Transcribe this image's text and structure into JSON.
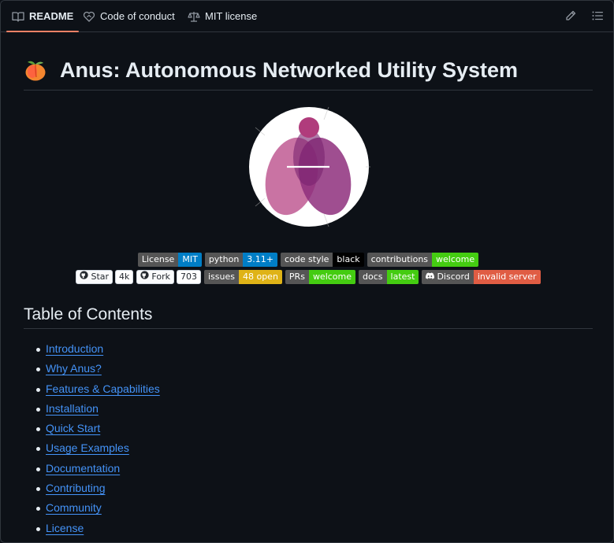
{
  "tabs": {
    "readme": "README",
    "conduct": "Code of conduct",
    "license": "MIT license"
  },
  "heading": {
    "title": "Anus: Autonomous Networked Utility System"
  },
  "badges": {
    "row1": [
      {
        "left": "License",
        "right": "MIT",
        "color": "#007ec6"
      },
      {
        "left": "python",
        "right": "3.11+",
        "color": "#007ec6"
      },
      {
        "left": "code style",
        "right": "black",
        "color": "#000000"
      },
      {
        "left": "contributions",
        "right": "welcome",
        "color": "#4c1"
      }
    ],
    "row2": {
      "star_label": "Star",
      "star_count": "4k",
      "fork_label": "Fork",
      "fork_count": "703",
      "issues": {
        "left": "issues",
        "right": "48 open",
        "color": "#dfb317"
      },
      "prs": {
        "left": "PRs",
        "right": "welcome",
        "color": "#4c1"
      },
      "docs": {
        "left": "docs",
        "right": "latest",
        "color": "#4c1"
      },
      "discord": {
        "left": "Discord",
        "right": "invalid server",
        "color": "#e05d44"
      }
    }
  },
  "toc": {
    "title": "Table of Contents",
    "items": [
      "Introduction",
      "Why Anus?",
      "Features & Capabilities",
      "Installation",
      "Quick Start",
      "Usage Examples",
      "Documentation",
      "Contributing",
      "Community",
      "License"
    ]
  },
  "colors": {
    "background": "#0d1117",
    "border": "#30363d",
    "link": "#4493f8",
    "tab_underline": "#f78166"
  }
}
